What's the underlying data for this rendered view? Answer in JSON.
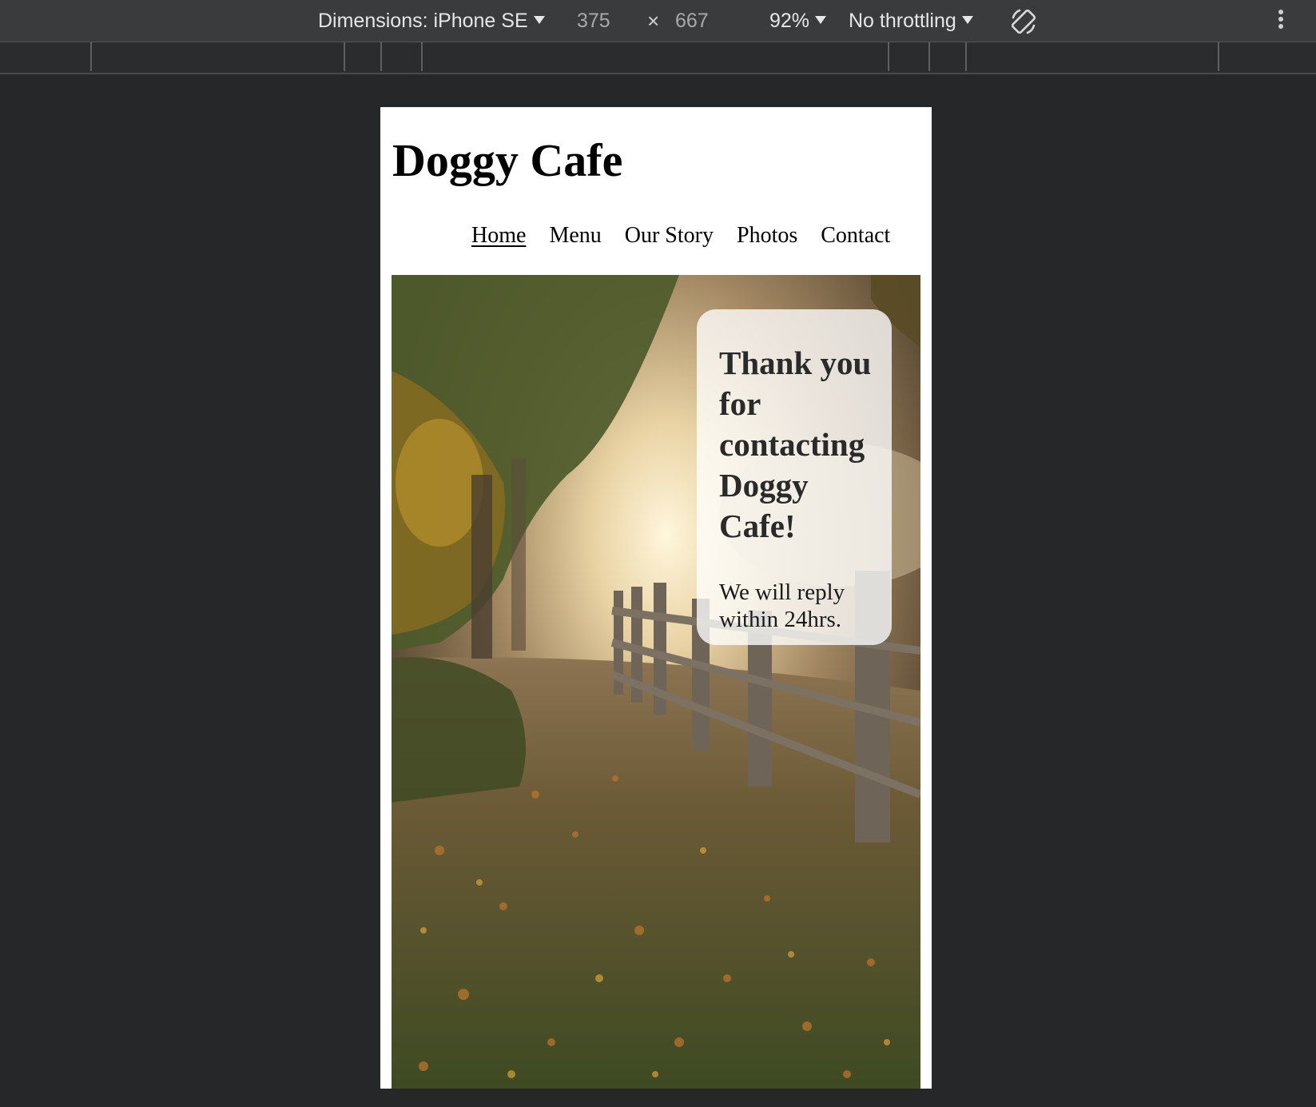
{
  "devtools": {
    "dimensions_label": "Dimensions: iPhone SE",
    "width": "375",
    "times": "×",
    "height": "667",
    "zoom": "92%",
    "throttling": "No throttling",
    "icons": [
      "rotate-icon",
      "more-icon",
      "caret-down-icon"
    ]
  },
  "site": {
    "title": "Doggy Cafe",
    "nav": [
      "Home",
      "Menu",
      "Our Story",
      "Photos",
      "Contact"
    ],
    "active_nav": "Home",
    "card": {
      "heading": "Thank you for contacting Doggy Cafe!",
      "text": "We will reply within 24hrs."
    }
  }
}
